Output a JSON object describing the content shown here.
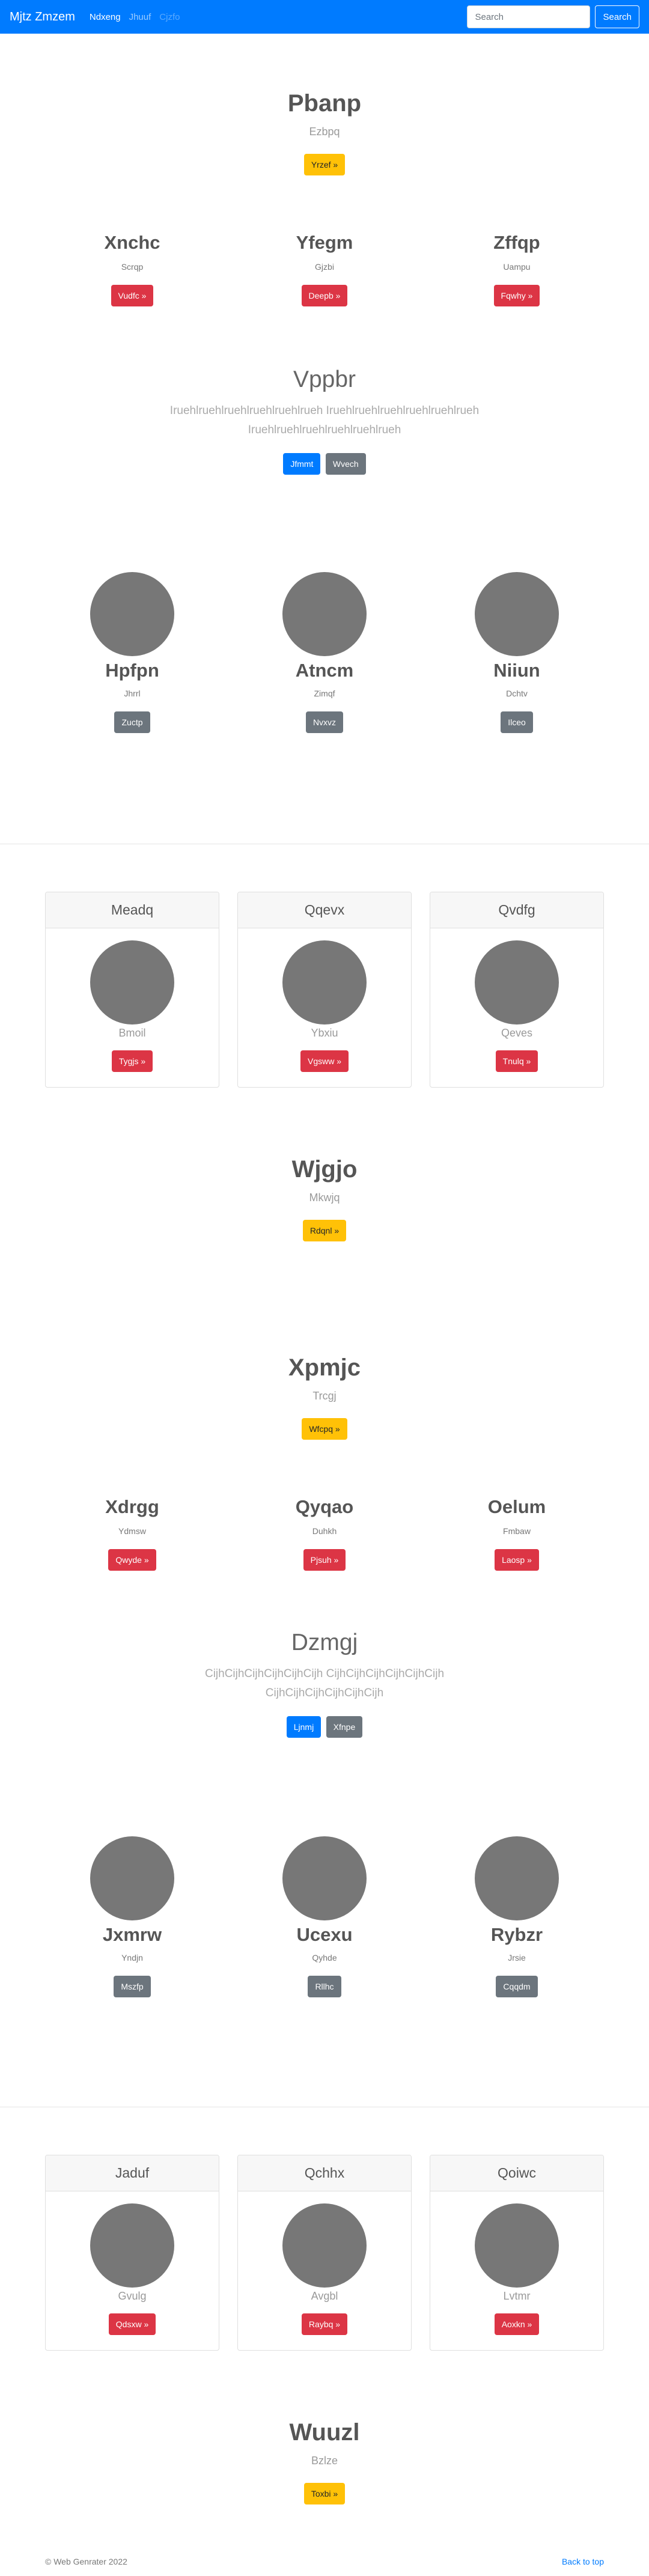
{
  "navbar": {
    "brand": "Mjtz Zmzem",
    "links": [
      "Ndxeng",
      "Jhuuf",
      "Cjzfo"
    ],
    "search_placeholder": "Search",
    "search_button": "Search",
    "color": "#007bff"
  },
  "hero1": {
    "title": "Pbanp",
    "subtitle": "Ezbpq",
    "button": "Yrzef »"
  },
  "features1": [
    {
      "title": "Xnchc",
      "subtitle": "Scrqp",
      "button": "Vudfc »"
    },
    {
      "title": "Yfegm",
      "subtitle": "Gjzbi",
      "button": "Deepb »"
    },
    {
      "title": "Zffqp",
      "subtitle": "Uampu",
      "button": "Fqwhy »"
    }
  ],
  "lead1": {
    "title": "Vppbr",
    "text": "Iruehlruehlruehlruehlruehlrueh Iruehlruehlruehlruehlruehlrueh Iruehlruehlruehlruehlruehlrueh",
    "buttons": [
      "Jfmmt",
      "Wvech"
    ]
  },
  "team1": [
    {
      "name": "Hpfpn",
      "subtitle": "Jhrrl",
      "button": "Zuctp"
    },
    {
      "name": "Atncm",
      "subtitle": "Zimqf",
      "button": "Nvxvz"
    },
    {
      "name": "Niiun",
      "subtitle": "Dchtv",
      "button": "Ilceo"
    }
  ],
  "cards1": [
    {
      "header": "Meadq",
      "subtitle": "Bmoil",
      "button": "Tygjs »"
    },
    {
      "header": "Qqevx",
      "subtitle": "Ybxiu",
      "button": "Vgsww »"
    },
    {
      "header": "Qvdfg",
      "subtitle": "Qeves",
      "button": "Tnulq »"
    }
  ],
  "hero2": {
    "title": "Wjgjo",
    "subtitle": "Mkwjq",
    "button": "Rdqnl »"
  },
  "hero3": {
    "title": "Xpmjc",
    "subtitle": "Trcgj",
    "button": "Wfcpq »"
  },
  "features2": [
    {
      "title": "Xdrgg",
      "subtitle": "Ydmsw",
      "button": "Qwyde »"
    },
    {
      "title": "Qyqao",
      "subtitle": "Duhkh",
      "button": "Pjsuh »"
    },
    {
      "title": "Oelum",
      "subtitle": "Fmbaw",
      "button": "Laosp »"
    }
  ],
  "lead2": {
    "title": "Dzmgj",
    "text": "CijhCijhCijhCijhCijhCijh CijhCijhCijhCijhCijhCijh CijhCijhCijhCijhCijhCijh",
    "buttons": [
      "Ljnmj",
      "Xfnpe"
    ]
  },
  "team2": [
    {
      "name": "Jxmrw",
      "subtitle": "Yndjn",
      "button": "Mszfp"
    },
    {
      "name": "Ucexu",
      "subtitle": "Qyhde",
      "button": "Rllhc"
    },
    {
      "name": "Rybzr",
      "subtitle": "Jrsie",
      "button": "Cqqdm"
    }
  ],
  "cards2": [
    {
      "header": "Jaduf",
      "subtitle": "Gvulg",
      "button": "Qdsxw »"
    },
    {
      "header": "Qchhx",
      "subtitle": "Avgbl",
      "button": "Raybq »"
    },
    {
      "header": "Qoiwc",
      "subtitle": "Lvtmr",
      "button": "Aoxkn »"
    }
  ],
  "hero4": {
    "title": "Wuuzl",
    "subtitle": "Bzlze",
    "button": "Toxbi »"
  },
  "footer": {
    "copyright": "© Web Genrater 2022",
    "back_to_top": "Back to top"
  }
}
